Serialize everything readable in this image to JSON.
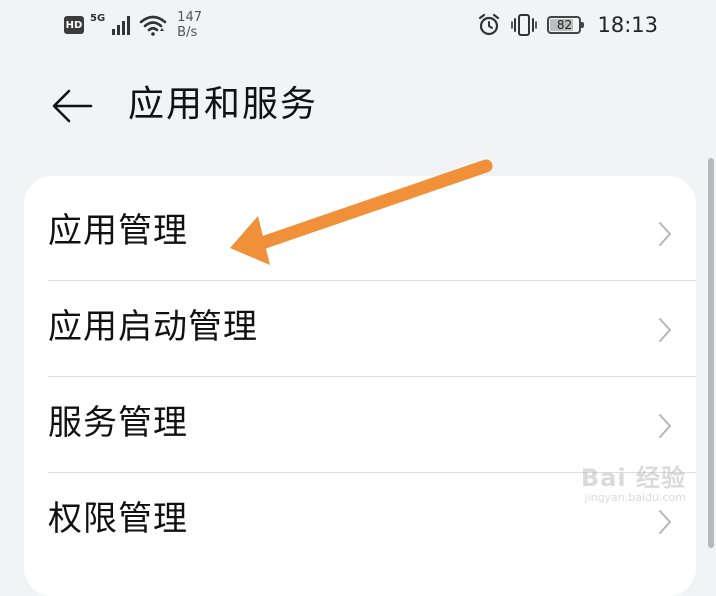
{
  "status_bar": {
    "hd_label": "HD",
    "network_type": "5G",
    "speed_value": "147",
    "speed_unit": "B/s",
    "battery_level": "82",
    "battery_fraction": 0.82,
    "time": "18:13",
    "icons": [
      "signal-icon",
      "wifi-icon",
      "alarm-icon",
      "vibrate-icon",
      "battery-icon"
    ]
  },
  "header": {
    "title": "应用和服务",
    "back_icon": "back-arrow-icon"
  },
  "menu": {
    "items": [
      {
        "label": "应用管理"
      },
      {
        "label": "应用启动管理"
      },
      {
        "label": "服务管理"
      },
      {
        "label": "权限管理"
      }
    ]
  },
  "annotation": {
    "arrow_color": "#f0913a"
  },
  "watermark": {
    "main": "Bai 经验",
    "sub": "jingyan.baidu.com"
  }
}
